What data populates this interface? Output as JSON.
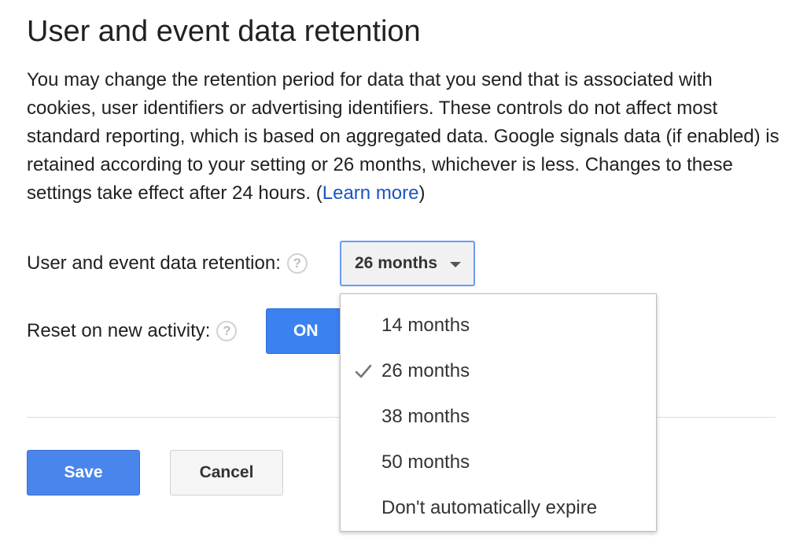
{
  "page": {
    "title": "User and event data retention",
    "description": "You may change the retention period for data that you send that is associated with cookies, user identifiers or advertising identifiers. These controls do not affect most standard reporting, which is based on aggregated data. Google signals data (if enabled) is retained according to your setting or 26 months, whichever is less. Changes to these settings take effect after 24 hours. (",
    "learn_more": "Learn more",
    "description_end": ")"
  },
  "retention": {
    "label": "User and event data retention:",
    "help_icon": "?",
    "selected": "26 months",
    "options": [
      {
        "label": "14 months",
        "checked": false
      },
      {
        "label": "26 months",
        "checked": true
      },
      {
        "label": "38 months",
        "checked": false
      },
      {
        "label": "50 months",
        "checked": false
      },
      {
        "label": "Don't automatically expire",
        "checked": false
      }
    ],
    "caret_icon": "caret-down-icon",
    "check_icon": "checkmark-icon"
  },
  "reset": {
    "label": "Reset on new activity:",
    "help_icon": "?",
    "toggle_label": "ON",
    "toggle_state": "on"
  },
  "actions": {
    "save_label": "Save",
    "cancel_label": "Cancel"
  },
  "colors": {
    "link": "#1a55c2",
    "primary_button": "#4a85ec",
    "toggle_on": "#3b82f0",
    "select_border": "#6b9bf2"
  }
}
